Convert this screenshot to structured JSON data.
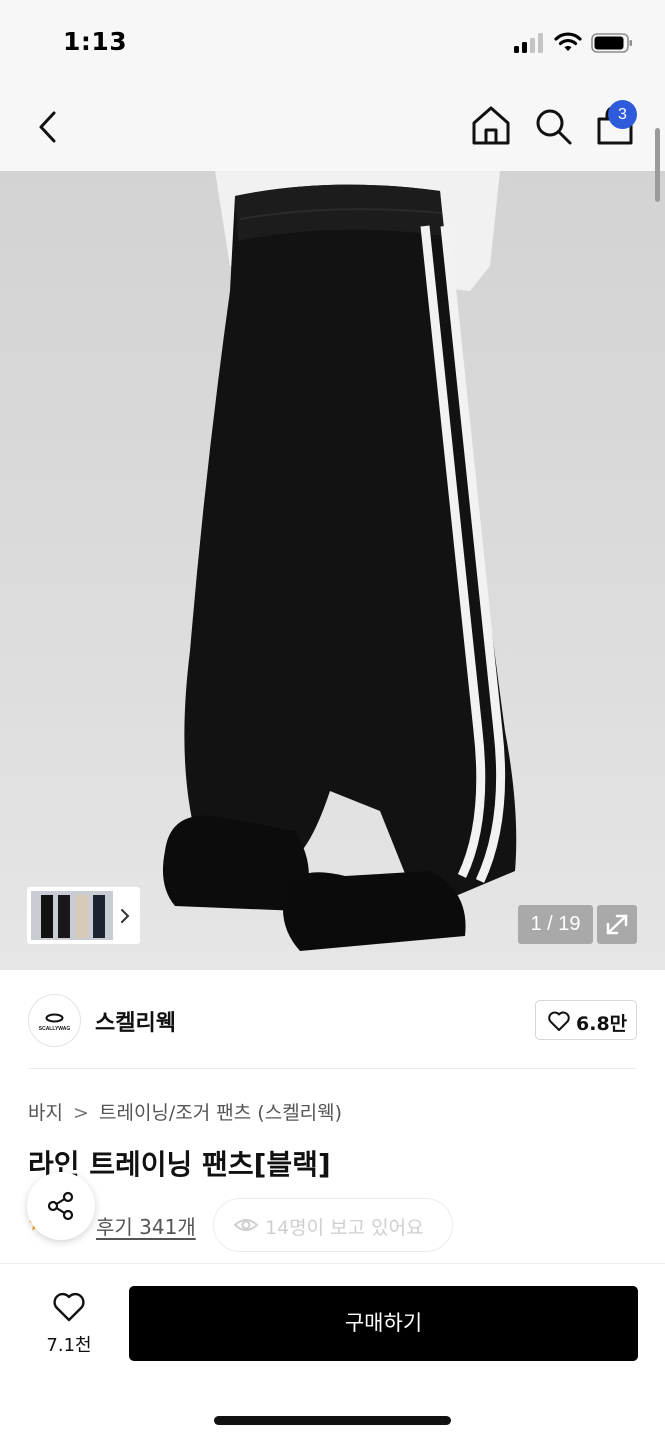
{
  "status_bar": {
    "time": "1:13"
  },
  "nav": {
    "cart_count": "3"
  },
  "gallery": {
    "counter": "1 / 19"
  },
  "brand": {
    "name": "스켈리웩",
    "logo_text": "SCALLYWAG",
    "like_count": "6.8만"
  },
  "breadcrumb": {
    "category": "바지",
    "separator": ">",
    "subcategory": "트레이닝/조거 팬츠 (스켈리웩)"
  },
  "product": {
    "title": "라인 트레이닝 팬츠[블랙]"
  },
  "reviews": {
    "label": "후기 341개"
  },
  "viewers": {
    "text": "14명이 보고 있어요"
  },
  "bottom_bar": {
    "wish_count": "7.1천",
    "buy_label": "구매하기"
  },
  "colors": {
    "accent_badge": "#2e5bd9",
    "buy_button": "#000000",
    "rating_star": "#f5a623"
  }
}
